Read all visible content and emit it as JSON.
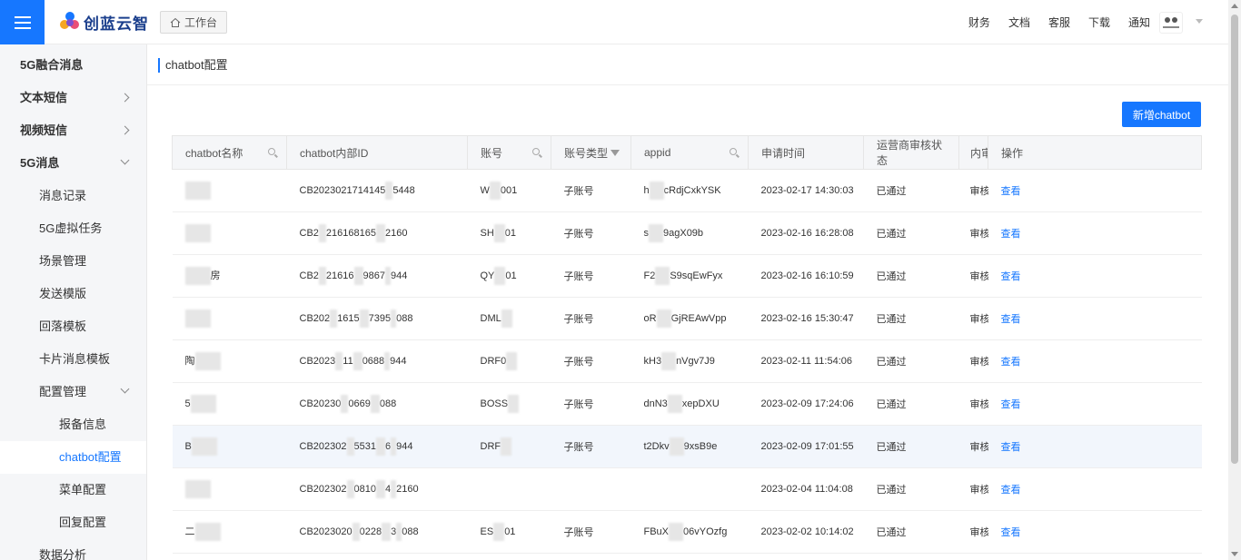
{
  "header": {
    "brand": "创蓝云智",
    "workbench": "工作台",
    "links": [
      "财务",
      "文档",
      "客服",
      "下载",
      "通知"
    ],
    "colors": {
      "accent": "#1677ff",
      "brand": "#1a3e8c"
    }
  },
  "sidebar": {
    "items": [
      {
        "label": "5G融合消息",
        "level": 1,
        "arrow": ""
      },
      {
        "label": "文本短信",
        "level": 1,
        "arrow": "right"
      },
      {
        "label": "视频短信",
        "level": 1,
        "arrow": "right"
      },
      {
        "label": "5G消息",
        "level": 1,
        "arrow": "down"
      },
      {
        "label": "消息记录",
        "level": 2,
        "arrow": ""
      },
      {
        "label": "5G虚拟任务",
        "level": 2,
        "arrow": ""
      },
      {
        "label": "场景管理",
        "level": 2,
        "arrow": ""
      },
      {
        "label": "发送模版",
        "level": 2,
        "arrow": ""
      },
      {
        "label": "回落模板",
        "level": 2,
        "arrow": ""
      },
      {
        "label": "卡片消息模板",
        "level": 2,
        "arrow": ""
      },
      {
        "label": "配置管理",
        "level": 2,
        "arrow": "down"
      },
      {
        "label": "报备信息",
        "level": 3,
        "arrow": ""
      },
      {
        "label": "chatbot配置",
        "level": 3,
        "arrow": "",
        "active": true
      },
      {
        "label": "菜单配置",
        "level": 3,
        "arrow": ""
      },
      {
        "label": "回复配置",
        "level": 3,
        "arrow": ""
      },
      {
        "label": "数据分析",
        "level": 2,
        "arrow": ""
      }
    ]
  },
  "main": {
    "page_title": "chatbot配置",
    "new_button": "新增chatbot",
    "columns": [
      "chatbot名称",
      "chatbot内部ID",
      "账号",
      "账号类型",
      "appid",
      "申请时间",
      "运营商审核状态",
      "内审",
      "操作"
    ],
    "rows": [
      {
        "name": "",
        "id": "CB2023021714145",
        "id2": "5448",
        "account": "W",
        "account2": "001",
        "type": "子账号",
        "appid": "h",
        "appid2": "cRdjCxkYSK",
        "time": "2023-02-17 14:30:03",
        "status": "已通过",
        "inner": "审核",
        "op": "查看"
      },
      {
        "name": "",
        "id": "CB2",
        "id2": "216168165",
        "id3": "2160",
        "account": "SH",
        "account2": "01",
        "type": "子账号",
        "appid": "s",
        "appid2": "9agX09b",
        "time": "2023-02-16 16:28:08",
        "status": "已通过",
        "inner": "审核",
        "op": "查看"
      },
      {
        "name": "",
        "name2": "房",
        "id": "CB2",
        "id2": "21616",
        "id3": "9867",
        "id4": "944",
        "account": "QY",
        "account2": "01",
        "type": "子账号",
        "appid": "F2",
        "appid2": "S9sqEwFyx",
        "time": "2023-02-16 16:10:59",
        "status": "已通过",
        "inner": "审核",
        "op": "查看"
      },
      {
        "name": "",
        "id": "CB202",
        "id2": "1615",
        "id3": "7395",
        "id4": "088",
        "account": "DML",
        "account2": "",
        "type": "子账号",
        "appid": "oR",
        "appid2": "GjREAwVpp",
        "time": "2023-02-16 15:30:47",
        "status": "已通过",
        "inner": "审核",
        "op": "查看"
      },
      {
        "name": "陶",
        "id": "CB2023",
        "id2": "11",
        "id3": "0688",
        "id4": "944",
        "account": "DRF0",
        "account2": "",
        "type": "子账号",
        "appid": "kH3",
        "appid2": "nVgv7J9",
        "time": "2023-02-11 11:54:06",
        "status": "已通过",
        "inner": "审核",
        "op": "查看"
      },
      {
        "name": "5",
        "id": "CB20230",
        "id2": "0669",
        "id3": "088",
        "account": "BOSS",
        "account2": "",
        "type": "子账号",
        "appid": "dnN3",
        "appid2": "xepDXU",
        "time": "2023-02-09 17:24:06",
        "status": "已通过",
        "inner": "审核",
        "op": "查看"
      },
      {
        "name": "B",
        "id": "CB202302",
        "id2": "5531",
        "id3": "6",
        "id4": "944",
        "account": "DRF",
        "account2": "",
        "type": "子账号",
        "appid": "t2Dkv",
        "appid2": "9xsB9e",
        "time": "2023-02-09 17:01:55",
        "status": "已通过",
        "inner": "审核",
        "op": "查看",
        "hover": true
      },
      {
        "name": "",
        "id": "CB202302",
        "id2": "0810",
        "id3": "4",
        "id4": "2160",
        "account": "",
        "account2": "",
        "type": "",
        "appid": "",
        "appid2": "",
        "time": "2023-02-04 11:04:08",
        "status": "已通过",
        "inner": "审核",
        "op": "查看"
      },
      {
        "name": "二",
        "id": "CB2023020",
        "id2": "0228",
        "id3": "3",
        "id4": "088",
        "account": "ES",
        "account2": "01",
        "type": "子账号",
        "appid": "FBuX",
        "appid2": "06vYOzfg",
        "time": "2023-02-02 10:14:02",
        "status": "已通过",
        "inner": "审核",
        "op": "查看"
      }
    ]
  }
}
